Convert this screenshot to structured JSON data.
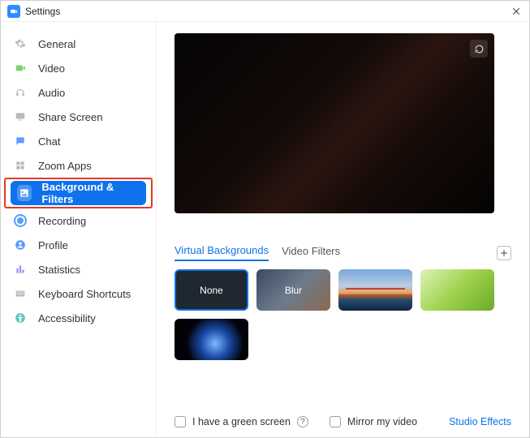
{
  "window": {
    "title": "Settings"
  },
  "sidebar": {
    "items": [
      {
        "label": "General"
      },
      {
        "label": "Video"
      },
      {
        "label": "Audio"
      },
      {
        "label": "Share Screen"
      },
      {
        "label": "Chat"
      },
      {
        "label": "Zoom Apps"
      },
      {
        "label": "Background & Filters"
      },
      {
        "label": "Recording"
      },
      {
        "label": "Profile"
      },
      {
        "label": "Statistics"
      },
      {
        "label": "Keyboard Shortcuts"
      },
      {
        "label": "Accessibility"
      }
    ],
    "active_index": 6
  },
  "content": {
    "tabs": {
      "virtual_backgrounds": "Virtual Backgrounds",
      "video_filters": "Video Filters",
      "selected": "virtual_backgrounds"
    },
    "thumbs": {
      "none": "None",
      "blur": "Blur",
      "golden_gate": "golden-gate-bridge",
      "grass": "grass",
      "earth": "earth-from-space",
      "selected": "none"
    },
    "footer": {
      "green_screen": "I have a green screen",
      "mirror": "Mirror my video",
      "studio_effects": "Studio Effects"
    }
  }
}
